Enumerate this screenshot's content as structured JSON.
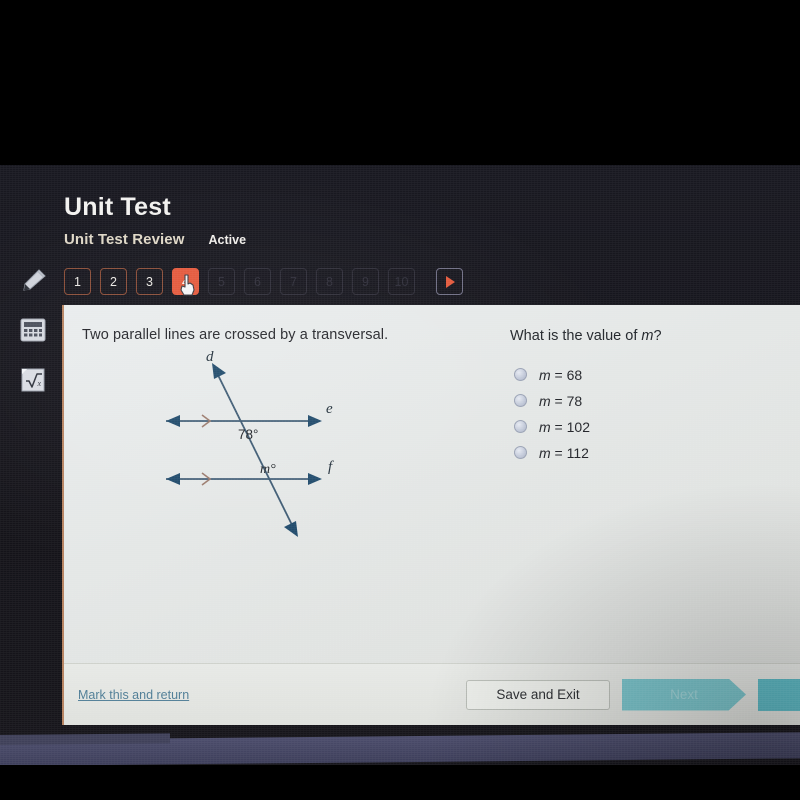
{
  "header": {
    "title": "Unit Test",
    "subtitle": "Unit Test Review",
    "status": "Active"
  },
  "question_strip": {
    "buttons": [
      {
        "label": "1",
        "state": "done"
      },
      {
        "label": "2",
        "state": "done"
      },
      {
        "label": "3",
        "state": "done"
      },
      {
        "label": "4",
        "state": "current"
      },
      {
        "label": "5",
        "state": "locked"
      },
      {
        "label": "6",
        "state": "locked"
      },
      {
        "label": "7",
        "state": "locked"
      },
      {
        "label": "8",
        "state": "locked"
      },
      {
        "label": "9",
        "state": "locked"
      },
      {
        "label": "10",
        "state": "locked"
      }
    ],
    "play_button": "play-icon"
  },
  "tool_rail": {
    "items": [
      {
        "name": "highlighter-tool",
        "icon": "highlighter-icon"
      },
      {
        "name": "calculator-tool",
        "icon": "calculator-icon"
      },
      {
        "name": "math-tool",
        "icon": "square-root-icon"
      }
    ]
  },
  "question": {
    "stem": "Two parallel lines are crossed by a transversal.",
    "prompt_prefix": "What is the value of ",
    "prompt_var": "m",
    "prompt_suffix": "?",
    "choices": [
      {
        "var": "m",
        "eq": " = ",
        "value": "68"
      },
      {
        "var": "m",
        "eq": " = ",
        "value": "78"
      },
      {
        "var": "m",
        "eq": " = ",
        "value": "102"
      },
      {
        "var": "m",
        "eq": " = ",
        "value": "112"
      }
    ]
  },
  "diagram": {
    "labels": {
      "transversal": "d",
      "line_upper": "e",
      "line_lower": "f",
      "angle_known": "78°",
      "angle_unknown": "m°"
    },
    "line_color": "#3d5a73",
    "arrow_color": "#1f4a6b",
    "tick_color": "#9b7b6d"
  },
  "footer": {
    "mark_link": "Mark this and return",
    "save_label": "Save and Exit",
    "next_label": "Next"
  },
  "colors": {
    "accent_orange": "#e4593c",
    "teal_next": "#79c4cb",
    "link_blue": "#4f7d96",
    "navy_bezel": "#43445f"
  }
}
